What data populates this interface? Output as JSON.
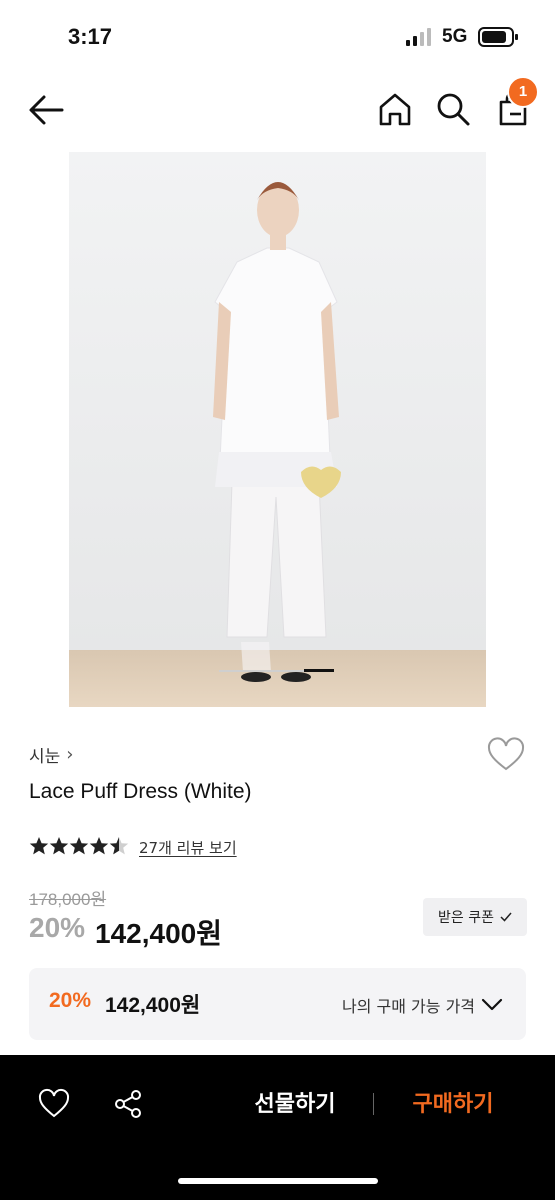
{
  "status_bar": {
    "time": "3:17",
    "network": "5G"
  },
  "header": {
    "back_icon": "back-arrow-icon",
    "home_icon": "home-icon",
    "search_icon": "search-icon",
    "cart_icon": "shopping-bag-icon",
    "cart_count": "1"
  },
  "product": {
    "brand": "시눈",
    "brand_chevron": "›",
    "title": "Lace Puff Dress (White)",
    "rating": 4.5,
    "review_link": "27개 리뷰 보기",
    "original_price": "178,000원",
    "discount": "20%",
    "price": "142,400원",
    "coupon_label": "받은 쿠폰",
    "my_price": {
      "discount": "20%",
      "price": "142,400원",
      "label": "나의 구매 가능 가격"
    }
  },
  "bottom_bar": {
    "gift_label": "선물하기",
    "buy_label": "구매하기"
  },
  "colors": {
    "accent": "#f26a20",
    "dark": "#000000"
  }
}
